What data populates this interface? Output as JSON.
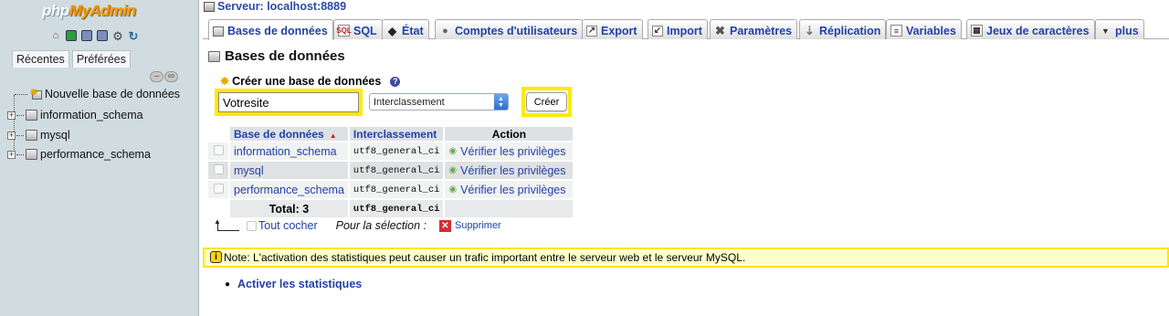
{
  "app": {
    "logo_part1": "php",
    "logo_part2": "MyAdmin"
  },
  "nav": {
    "tabs": [
      {
        "label": "Récentes"
      },
      {
        "label": "Préférées"
      }
    ],
    "tree": {
      "new_db": "Nouvelle base de données",
      "items": [
        {
          "label": "information_schema"
        },
        {
          "label": "mysql"
        },
        {
          "label": "performance_schema"
        }
      ]
    }
  },
  "header": {
    "server": "Serveur: localhost:8889"
  },
  "tabs": [
    {
      "label": "Bases de données",
      "icon": "database-icon",
      "active": true
    },
    {
      "label": "SQL",
      "icon": "sql-icon"
    },
    {
      "label": "État",
      "icon": "status-icon"
    },
    {
      "label": "Comptes d'utilisateurs",
      "icon": "users-icon"
    },
    {
      "label": "Export",
      "icon": "export-icon"
    },
    {
      "label": "Import",
      "icon": "import-icon"
    },
    {
      "label": "Paramètres",
      "icon": "settings-icon"
    },
    {
      "label": "Réplication",
      "icon": "replication-icon"
    },
    {
      "label": "Variables",
      "icon": "variables-icon"
    },
    {
      "label": "Jeux de caractères",
      "icon": "charsets-icon"
    },
    {
      "label": "plus",
      "icon": "chevron-down-icon"
    }
  ],
  "page": {
    "title": "Bases de données",
    "create_heading": "Créer une base de données",
    "db_name_value": "Votresite",
    "collation_select": "Interclassement",
    "create_button": "Créer"
  },
  "table": {
    "headers": {
      "database": "Base de données",
      "collation": "Interclassement",
      "action": "Action"
    },
    "rows": [
      {
        "name": "information_schema",
        "collation": "utf8_general_ci",
        "action": "Vérifier les privilèges"
      },
      {
        "name": "mysql",
        "collation": "utf8_general_ci",
        "action": "Vérifier les privilèges"
      },
      {
        "name": "performance_schema",
        "collation": "utf8_general_ci",
        "action": "Vérifier les privilèges"
      }
    ],
    "total_label": "Total: 3",
    "total_collation": "utf8_general_ci"
  },
  "selection": {
    "check_all": "Tout cocher",
    "for_selection": "Pour la sélection :",
    "delete": "Supprimer"
  },
  "note": {
    "text": "Note: L'activation des statistiques peut causer un trafic important entre le serveur web et le serveur MySQL."
  },
  "stats": {
    "link": "Activer les statistiques"
  },
  "colors": {
    "link": "#2340a6",
    "highlight": "#ffea00",
    "nav_bg": "#d0dce0",
    "note_bg": "#ffffcc"
  }
}
